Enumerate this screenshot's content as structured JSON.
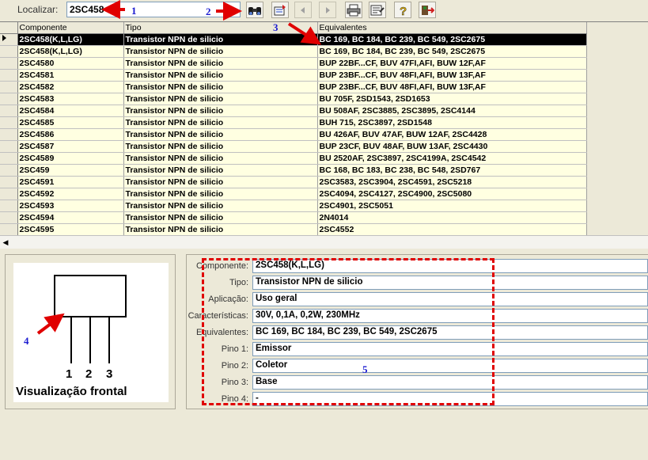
{
  "toolbar": {
    "search_label": "Localizar:",
    "search_value": "2SC458",
    "buttons": [
      "binoculars-icon",
      "filter-icon",
      "prev-icon",
      "next-icon",
      "print-icon",
      "properties-icon",
      "help-icon",
      "exit-icon"
    ]
  },
  "grid": {
    "columns": [
      "Componente",
      "Tipo",
      "Equivalentes"
    ],
    "rows": [
      {
        "componente": "2SC458(K,L,LG)",
        "tipo": "Transistor NPN de silicio",
        "equivalentes": "BC 169, BC 184, BC 239, BC 549, 2SC2675",
        "selected": true
      },
      {
        "componente": "2SC458(K,L,LG)",
        "tipo": "Transistor NPN de silicio",
        "equivalentes": "BC 169, BC 184, BC 239, BC 549, 2SC2675"
      },
      {
        "componente": "2SC4580",
        "tipo": "Transistor NPN de silicio",
        "equivalentes": "BUP 22BF...CF, BUV 47FI,AFI, BUW 12F,AF"
      },
      {
        "componente": "2SC4581",
        "tipo": "Transistor NPN de silicio",
        "equivalentes": "BUP 23BF...CF, BUV 48FI,AFI, BUW 13F,AF"
      },
      {
        "componente": "2SC4582",
        "tipo": "Transistor NPN de silicio",
        "equivalentes": "BUP 23BF...CF, BUV 48FI,AFI, BUW 13F,AF"
      },
      {
        "componente": "2SC4583",
        "tipo": "Transistor NPN de silicio",
        "equivalentes": "BU 705F, 2SD1543, 2SD1653"
      },
      {
        "componente": "2SC4584",
        "tipo": "Transistor NPN de silicio",
        "equivalentes": "BU 508AF, 2SC3885, 2SC3895, 2SC4144"
      },
      {
        "componente": "2SC4585",
        "tipo": "Transistor NPN de silicio",
        "equivalentes": "BUH 715, 2SC3897, 2SD1548"
      },
      {
        "componente": "2SC4586",
        "tipo": "Transistor NPN de silicio",
        "equivalentes": "BU 426AF, BUV 47AF, BUW 12AF, 2SC4428"
      },
      {
        "componente": "2SC4587",
        "tipo": "Transistor NPN de silicio",
        "equivalentes": "BUP 23CF, BUV 48AF, BUW 13AF, 2SC4430"
      },
      {
        "componente": "2SC4589",
        "tipo": "Transistor NPN de silicio",
        "equivalentes": "BU 2520AF, 2SC3897, 2SC4199A, 2SC4542"
      },
      {
        "componente": "2SC459",
        "tipo": "Transistor NPN de silicio",
        "equivalentes": "BC 168, BC 183, BC 238, BC 548, 2SD767"
      },
      {
        "componente": "2SC4591",
        "tipo": "Transistor NPN de silicio",
        "equivalentes": "2SC3583, 2SC3904, 2SC4591, 2SC5218"
      },
      {
        "componente": "2SC4592",
        "tipo": "Transistor NPN de silicio",
        "equivalentes": "2SC4094, 2SC4127, 2SC4900, 2SC5080"
      },
      {
        "componente": "2SC4593",
        "tipo": "Transistor NPN de silicio",
        "equivalentes": "2SC4901, 2SC5051"
      },
      {
        "componente": "2SC4594",
        "tipo": "Transistor NPN de silicio",
        "equivalentes": "2N4014"
      },
      {
        "componente": "2SC4595",
        "tipo": "Transistor NPN de silicio",
        "equivalentes": "2SC4552"
      }
    ]
  },
  "preview": {
    "pins": [
      "1",
      "2",
      "3"
    ],
    "caption": "Visualização frontal"
  },
  "details": {
    "fields": [
      {
        "label": "Componente:",
        "value": "2SC458(K,L,LG)"
      },
      {
        "label": "Tipo:",
        "value": "Transistor NPN de silicio"
      },
      {
        "label": "Aplicação:",
        "value": "Uso geral"
      },
      {
        "label": "Características:",
        "value": "30V, 0,1A, 0,2W, 230MHz"
      },
      {
        "label": "Equivalentes:",
        "value": "BC 169, BC 184, BC 239, BC 549, 2SC2675"
      },
      {
        "label": "Pino 1:",
        "value": "Emissor"
      },
      {
        "label": "Pino 2:",
        "value": "Coletor"
      },
      {
        "label": "Pino 3:",
        "value": "Base"
      },
      {
        "label": "Pino 4:",
        "value": "-"
      }
    ]
  },
  "annotations": {
    "numbers": [
      "1",
      "2",
      "3",
      "4",
      "5"
    ],
    "arrow_color": "#e00000",
    "number_color": "#1a1ad0"
  }
}
